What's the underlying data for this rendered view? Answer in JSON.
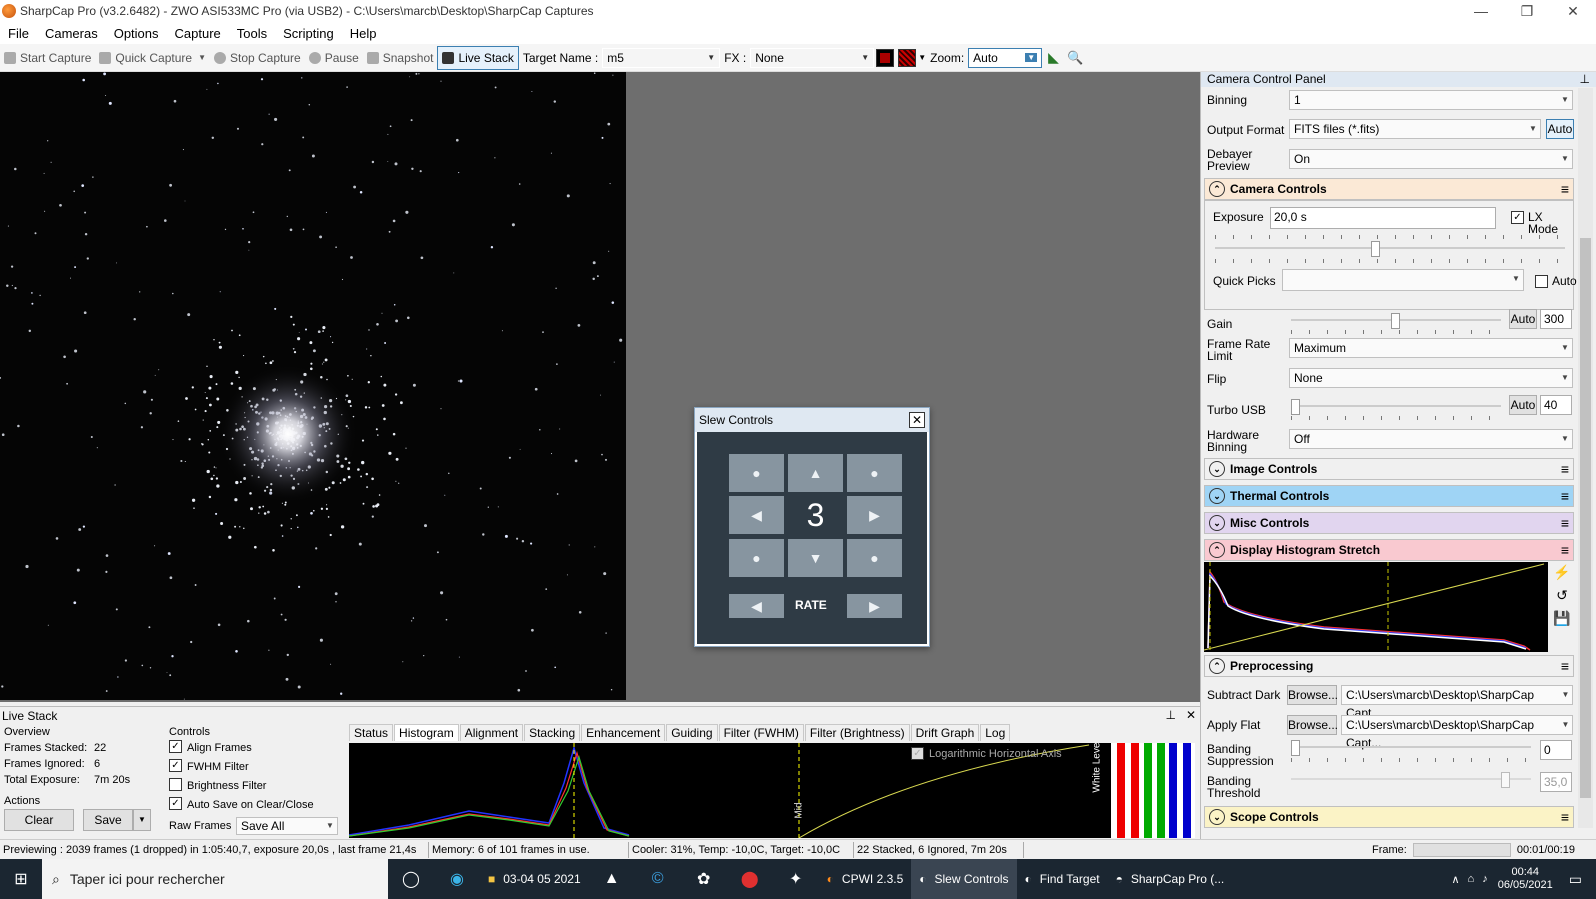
{
  "window": {
    "title": "SharpCap Pro (v3.2.6482) - ZWO ASI533MC Pro (via USB2) - C:\\Users\\marcb\\Desktop\\SharpCap Captures",
    "min": "—",
    "max": "❐",
    "close": "✕"
  },
  "menu": [
    "File",
    "Cameras",
    "Options",
    "Capture",
    "Tools",
    "Scripting",
    "Help"
  ],
  "toolbar": {
    "start_capture": "Start Capture",
    "quick_capture": "Quick Capture",
    "stop_capture": "Stop Capture",
    "pause": "Pause",
    "snapshot": "Snapshot",
    "live_stack": "Live Stack",
    "target_name_label": "Target Name :",
    "target_name_value": "m5",
    "fx_label": "FX :",
    "fx_value": "None",
    "zoom_label": "Zoom:",
    "zoom_value": "Auto"
  },
  "slew": {
    "title": "Slew Controls",
    "close": "✕",
    "rate_value": "3",
    "rate_label": "RATE",
    "up": "▲",
    "down": "▼",
    "left": "◀",
    "right": "▶",
    "dot": "●"
  },
  "live_stack": {
    "title": "Live Stack",
    "pin": "📌",
    "close": "✕",
    "overview_label": "Overview",
    "frames_stacked_label": "Frames Stacked:",
    "frames_stacked_value": "22",
    "frames_ignored_label": "Frames Ignored:",
    "frames_ignored_value": "6",
    "total_exposure_label": "Total Exposure:",
    "total_exposure_value": "7m 20s",
    "actions_label": "Actions",
    "clear": "Clear",
    "save": "Save",
    "controls_label": "Controls",
    "align_frames": "Align Frames",
    "fwhm_filter": "FWHM Filter",
    "brightness_filter": "Brightness Filter",
    "auto_save": "Auto Save on Clear/Close",
    "raw_frames_label": "Raw Frames",
    "raw_frames_value": "Save All",
    "tabs": [
      "Status",
      "Histogram",
      "Alignment",
      "Stacking",
      "Enhancement",
      "Guiding",
      "Filter (FWHM)",
      "Filter (Brightness)",
      "Drift Graph",
      "Log"
    ],
    "log_axis_label": "Logarithmic Horizontal Axis",
    "white_level_label": "White Level",
    "mid_level_label": "Mid"
  },
  "status": {
    "preview": "Previewing : 2039 frames (1 dropped) in 1:05:40,7, exposure 20,0s , last frame 21,4s",
    "memory": "Memory: 6 of 101 frames in use.",
    "cooler": "Cooler: 31%, Temp: -10,0C, Target: -10,0C",
    "stacked": "22 Stacked, 6 Ignored, 7m 20s",
    "frame_label": "Frame:",
    "time": "00:01/00:19"
  },
  "panel": {
    "title": "Camera Control Panel",
    "binning_label": "Binning",
    "binning_value": "1",
    "output_format_label": "Output Format",
    "output_format_value": "FITS files (*.fits)",
    "auto": "Auto",
    "debayer_label": "Debayer Preview",
    "debayer_value": "On",
    "camera_controls": "Camera Controls",
    "exposure_label": "Exposure",
    "exposure_value": "20,0 s",
    "lx_mode": "LX Mode",
    "quick_picks_label": "Quick Picks",
    "quick_auto": "Auto",
    "gain_label": "Gain",
    "gain_value": "300",
    "frame_rate_label": "Frame Rate Limit",
    "frame_rate_value": "Maximum",
    "flip_label": "Flip",
    "flip_value": "None",
    "turbo_label": "Turbo USB",
    "turbo_value": "40",
    "hw_binning_label": "Hardware Binning",
    "hw_binning_value": "Off",
    "image_controls": "Image Controls",
    "thermal_controls": "Thermal Controls",
    "misc_controls": "Misc Controls",
    "display_histogram": "Display Histogram Stretch",
    "preprocessing": "Preprocessing",
    "subtract_dark_label": "Subtract Dark",
    "apply_flat_label": "Apply Flat",
    "browse": "Browse...",
    "dark_path": "C:\\Users\\marcb\\Desktop\\SharpCap Capt...",
    "flat_path": "C:\\Users\\marcb\\Desktop\\SharpCap Capt...",
    "banding_suppression_label": "Banding Suppression",
    "banding_suppression_value": "0",
    "banding_threshold_label": "Banding Threshold",
    "banding_threshold_value": "35,0",
    "scope_controls": "Scope Controls"
  },
  "taskbar": {
    "search_placeholder": "Taper ici pour rechercher",
    "folder": "03-04 05 2021",
    "cpwi": "CPWI 2.3.5",
    "slew": "Slew Controls",
    "find_target": "Find Target",
    "sharpcap": "SharpCap Pro (...",
    "clock_time": "00:44",
    "clock_date": "06/05/2021"
  },
  "colors": {
    "camera_controls": "#fbe9d6",
    "thermal_controls": "#9fd4f5",
    "misc_controls": "#e1d5ef",
    "display_histogram": "#f9c9d0",
    "scope_controls": "#fbf3c6",
    "preprocessing": "#f0f0f0"
  }
}
